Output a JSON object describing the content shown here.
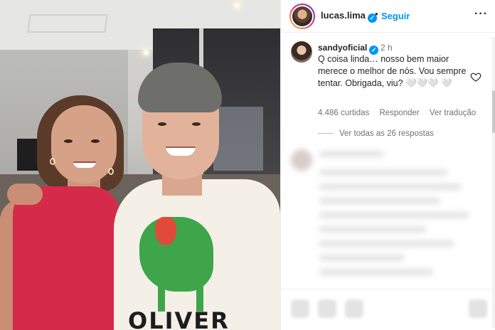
{
  "post": {
    "username": "lucas.lima",
    "separator": "•",
    "follow_label": "Seguir",
    "more_label": "···",
    "shirt_print": "OLIVER"
  },
  "comment": {
    "username": "sandyoficial",
    "time": "2 h",
    "text": "Q coisa linda… nosso bem maior merece o melhor de nós. Vou sempre tentar. Obrigada, viu? 🤍🤍🤍 🤍",
    "likes": "4.486 curtidas",
    "reply_label": "Responder",
    "translate_label": "Ver tradução",
    "view_replies_label": "Ver todas as 26 respostas"
  },
  "colors": {
    "link_blue": "#0095f6",
    "text_primary": "#262626",
    "text_secondary": "#737373"
  },
  "icons": [
    "verified-badge-icon",
    "more-options-icon",
    "heart-icon"
  ]
}
